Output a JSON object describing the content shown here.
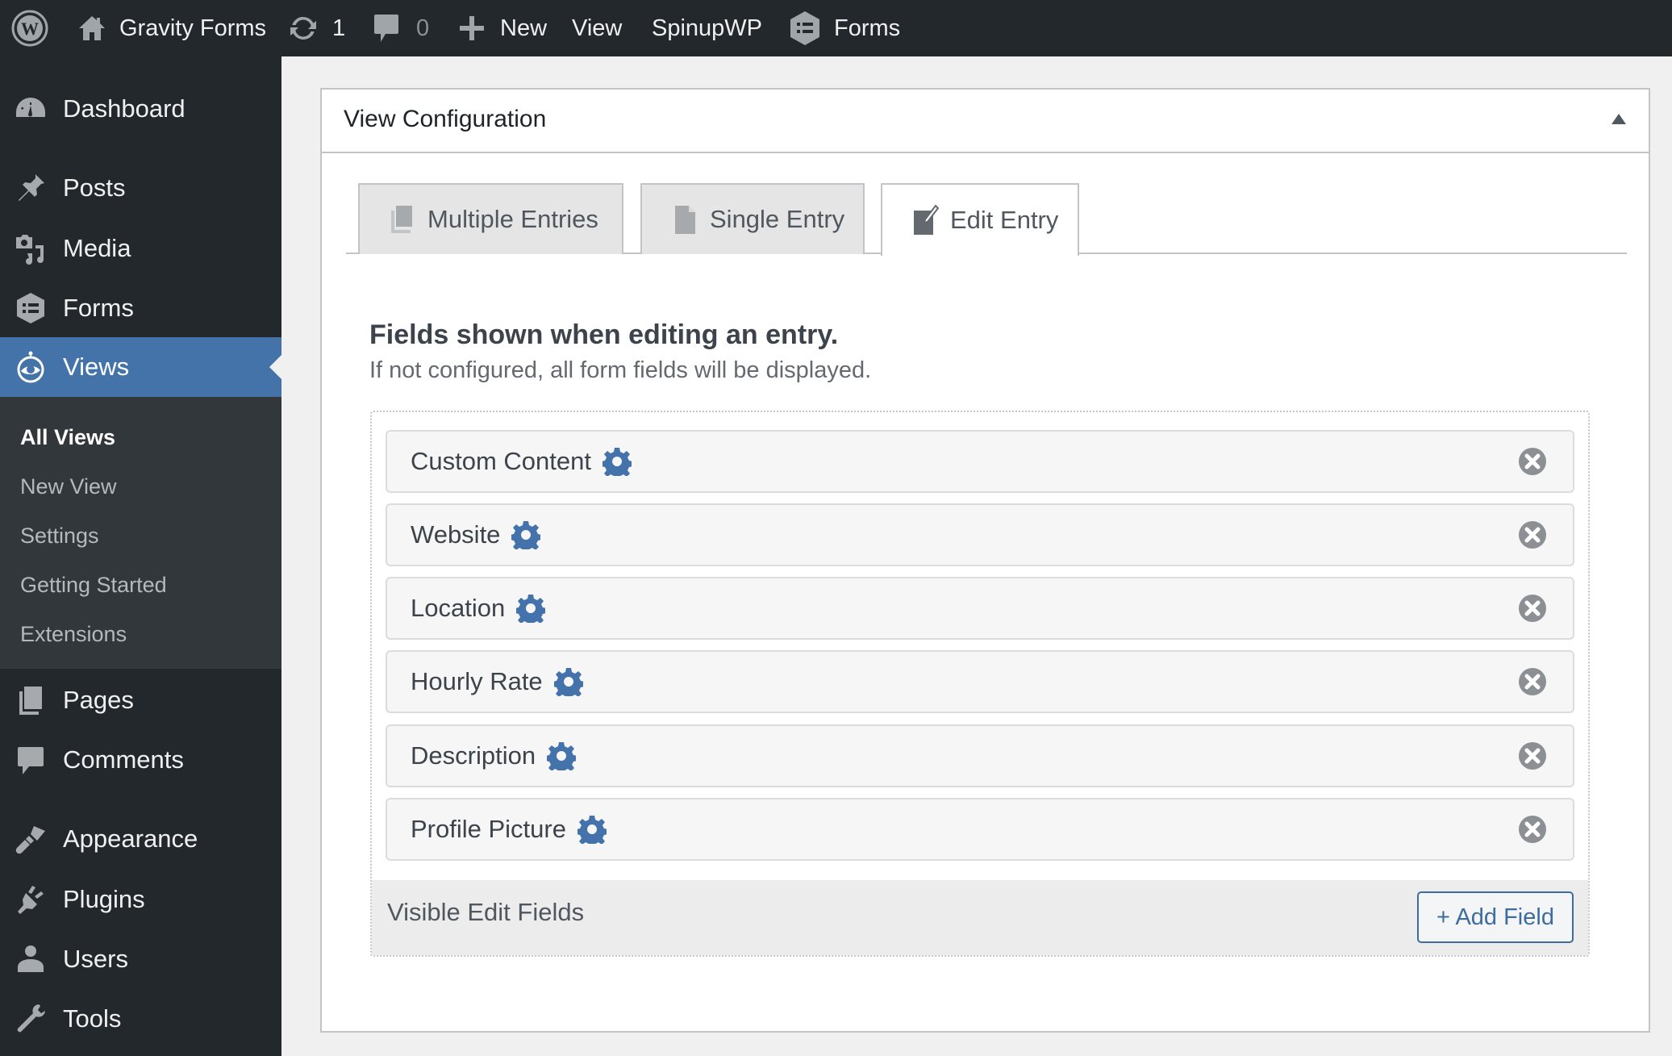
{
  "admin_bar": {
    "site_name": "Gravity Forms",
    "updates_count": "1",
    "comments_count": "0",
    "new_label": "New",
    "view_label": "View",
    "spinup_label": "SpinupWP",
    "forms_label": "Forms"
  },
  "sidebar": {
    "items": [
      {
        "label": "Dashboard",
        "icon": "dashboard-icon"
      },
      {
        "label": "Posts",
        "icon": "pin-icon"
      },
      {
        "label": "Media",
        "icon": "media-icon"
      },
      {
        "label": "Forms",
        "icon": "forms-icon"
      },
      {
        "label": "Views",
        "icon": "views-icon",
        "active": true
      },
      {
        "label": "Pages",
        "icon": "pages-icon"
      },
      {
        "label": "Comments",
        "icon": "comment-icon"
      },
      {
        "label": "Appearance",
        "icon": "paintbrush-icon"
      },
      {
        "label": "Plugins",
        "icon": "plugin-icon"
      },
      {
        "label": "Users",
        "icon": "user-icon"
      },
      {
        "label": "Tools",
        "icon": "wrench-icon"
      }
    ],
    "submenu": [
      {
        "label": "All Views",
        "current": true
      },
      {
        "label": "New View"
      },
      {
        "label": "Settings"
      },
      {
        "label": "Getting Started"
      },
      {
        "label": "Extensions"
      }
    ]
  },
  "panel": {
    "title": "View Configuration",
    "tabs": [
      {
        "label": "Multiple Entries",
        "icon": "multiple-pages-icon"
      },
      {
        "label": "Single Entry",
        "icon": "page-icon"
      },
      {
        "label": "Edit Entry",
        "icon": "edit-icon",
        "active": true
      }
    ],
    "heading": "Fields shown when editing an entry.",
    "subheading": "If not configured, all form fields will be displayed.",
    "fields": [
      {
        "label": "Custom Content"
      },
      {
        "label": "Website"
      },
      {
        "label": "Location"
      },
      {
        "label": "Hourly Rate"
      },
      {
        "label": "Description"
      },
      {
        "label": "Profile Picture"
      }
    ],
    "footer_label": "Visible Edit Fields",
    "add_field_label": "+ Add Field"
  },
  "colors": {
    "admin_bar_bg": "#23282d",
    "accent": "#4473aa",
    "gear": "#4472aa",
    "button_border": "#3e6c9e"
  }
}
